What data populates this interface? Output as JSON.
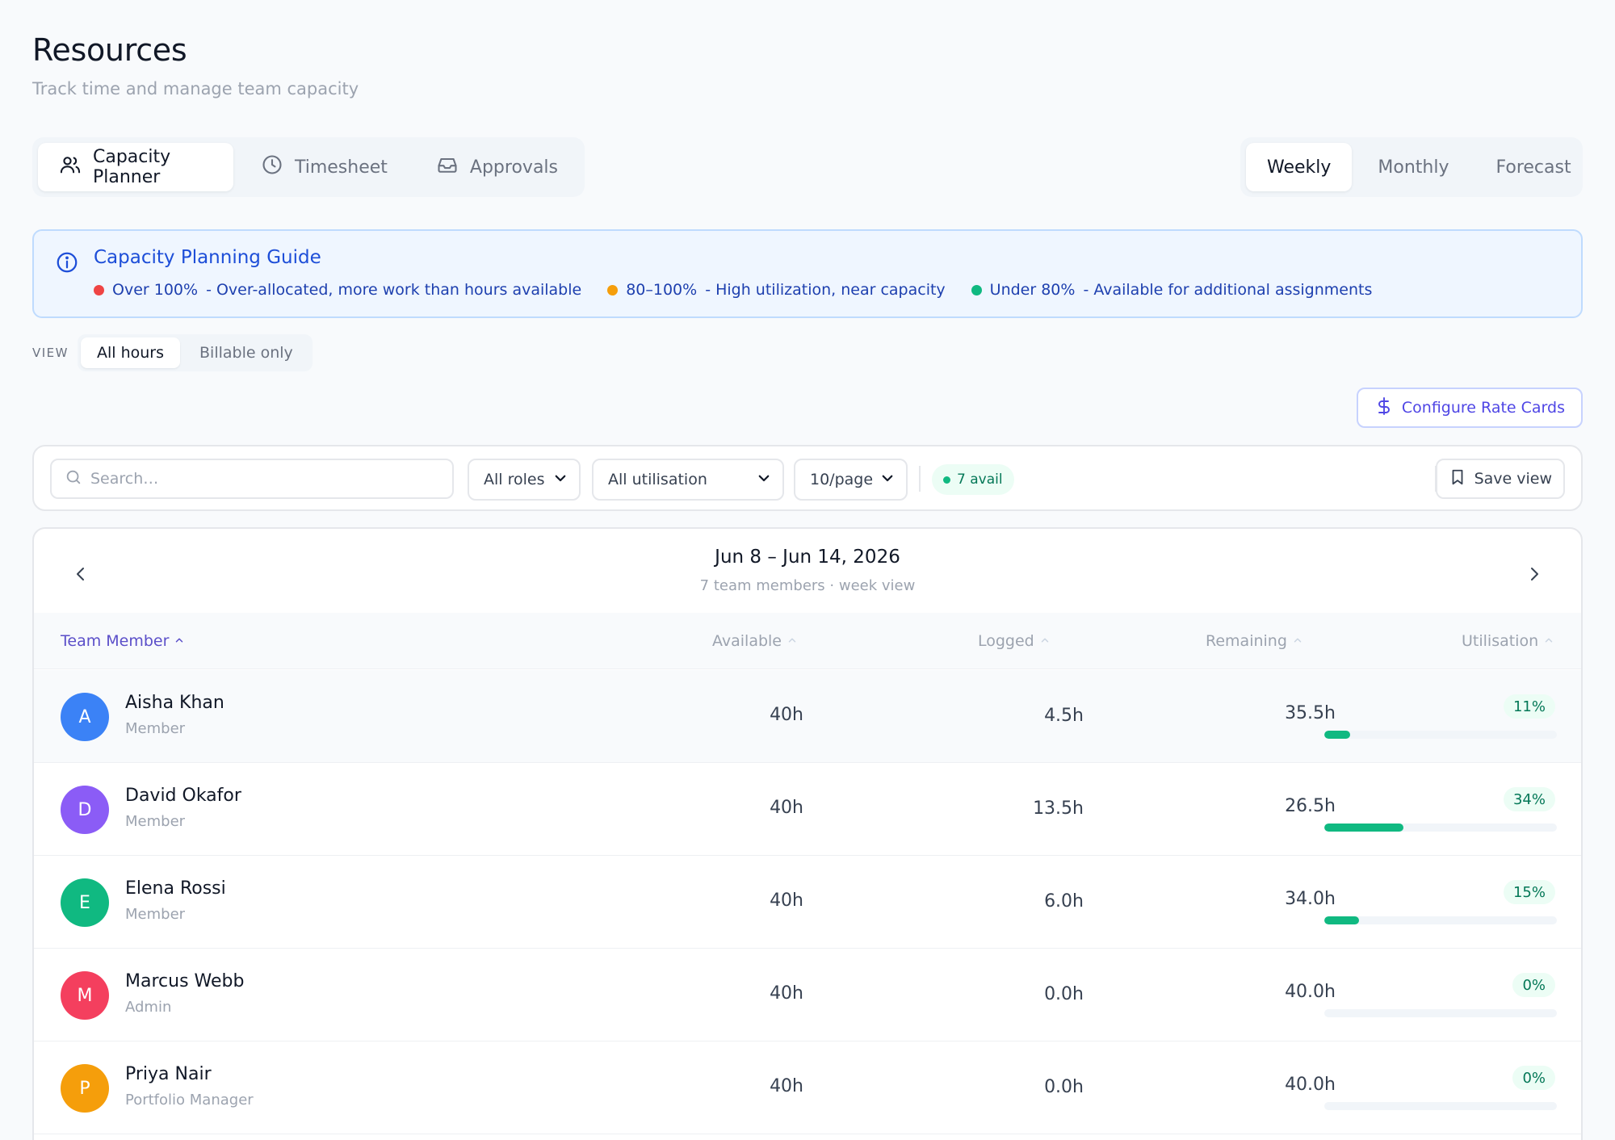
{
  "header": {
    "title": "Resources",
    "subtitle": "Track time and manage team capacity"
  },
  "tabs": [
    {
      "label": "Capacity Planner",
      "icon": "users-icon",
      "active": true
    },
    {
      "label": "Timesheet",
      "icon": "clock-icon",
      "active": false
    },
    {
      "label": "Approvals",
      "icon": "inbox-icon",
      "active": false
    }
  ],
  "period_tabs": [
    {
      "label": "Weekly",
      "active": true
    },
    {
      "label": "Monthly",
      "active": false
    },
    {
      "label": "Forecast",
      "active": false
    }
  ],
  "guide": {
    "title": "Capacity Planning Guide",
    "items": [
      {
        "range": "Over 100%",
        "desc": "- Over-allocated, more work than hours available",
        "color": "#ef4444"
      },
      {
        "range": "80–100%",
        "desc": "- High utilization, near capacity",
        "color": "#f59e0b"
      },
      {
        "range": "Under 80%",
        "desc": "- Available for additional assignments",
        "color": "#10b981"
      }
    ]
  },
  "view": {
    "label": "VIEW",
    "options": [
      {
        "label": "All hours",
        "active": true
      },
      {
        "label": "Billable only",
        "active": false
      }
    ]
  },
  "rate_button": {
    "label": "Configure Rate Cards"
  },
  "filters": {
    "search_placeholder": "Search…",
    "roles": "All roles",
    "utilisation": "All utilisation",
    "page_size": "10/page",
    "avail_badge": "7 avail",
    "save_view": "Save view"
  },
  "week": {
    "range": "Jun 8 – Jun 14, 2026",
    "summary": "7 team members · week view"
  },
  "columns": {
    "member": "Team Member",
    "available": "Available",
    "logged": "Logged",
    "remaining": "Remaining",
    "utilisation": "Utilisation"
  },
  "rows": [
    {
      "initial": "A",
      "name": "Aisha Khan",
      "role": "Member",
      "available": "40h",
      "logged": "4.5h",
      "remaining": "35.5h",
      "util": "11%",
      "util_value": 11,
      "color": "#3b82f6"
    },
    {
      "initial": "D",
      "name": "David Okafor",
      "role": "Member",
      "available": "40h",
      "logged": "13.5h",
      "remaining": "26.5h",
      "util": "34%",
      "util_value": 34,
      "color": "#8b5cf6"
    },
    {
      "initial": "E",
      "name": "Elena Rossi",
      "role": "Member",
      "available": "40h",
      "logged": "6.0h",
      "remaining": "34.0h",
      "util": "15%",
      "util_value": 15,
      "color": "#10b981"
    },
    {
      "initial": "M",
      "name": "Marcus Webb",
      "role": "Admin",
      "available": "40h",
      "logged": "0.0h",
      "remaining": "40.0h",
      "util": "0%",
      "util_value": 0,
      "color": "#f43f5e"
    },
    {
      "initial": "P",
      "name": "Priya Nair",
      "role": "Portfolio Manager",
      "available": "40h",
      "logged": "0.0h",
      "remaining": "40.0h",
      "util": "0%",
      "util_value": 0,
      "color": "#f59e0b"
    }
  ]
}
